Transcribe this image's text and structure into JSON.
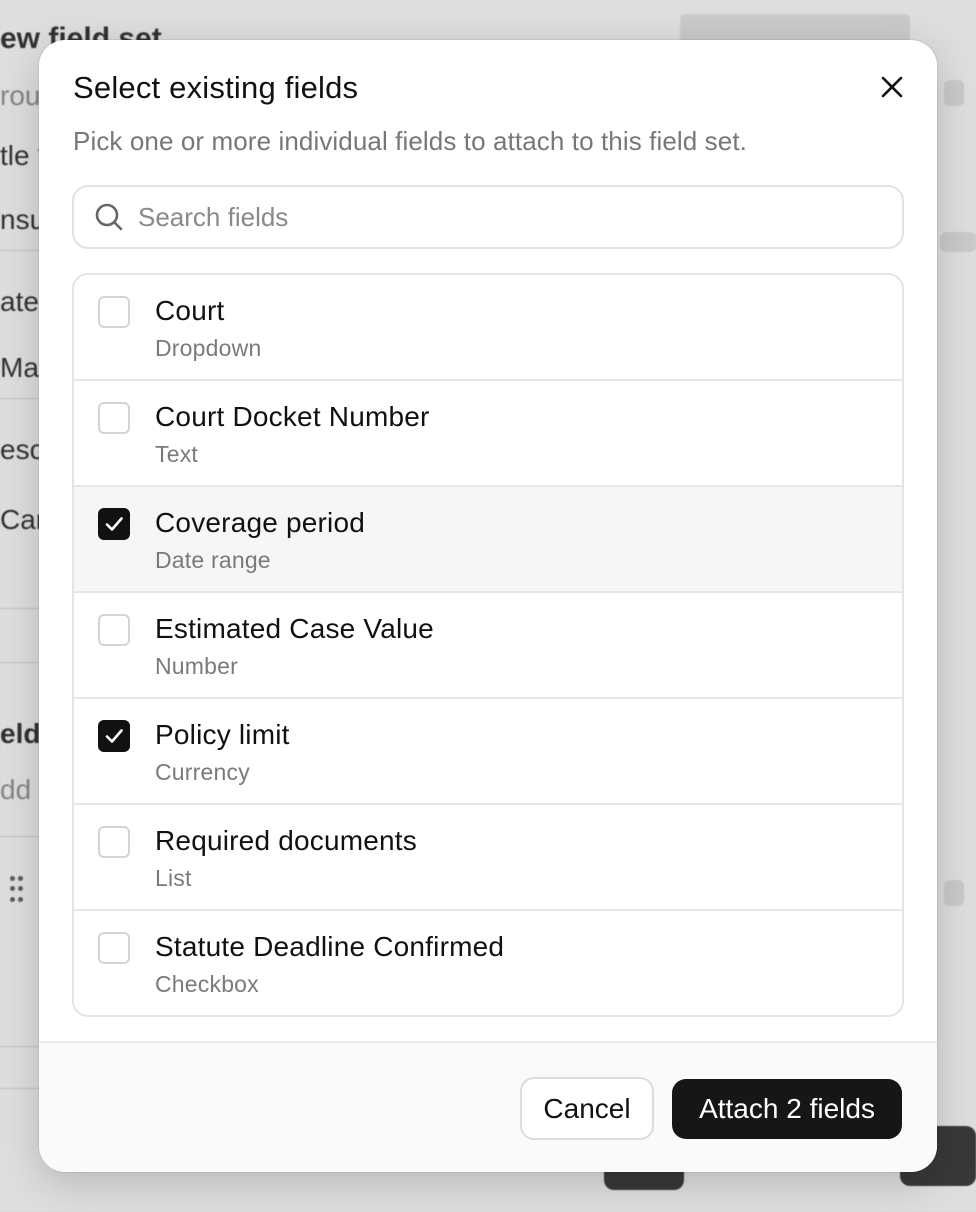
{
  "background": {
    "heading": "ew field set",
    "group_label": "rou",
    "title_label": "tle",
    "title_value": "nsu",
    "category_label": "ateg",
    "category_value": "Mat",
    "description_label": "esc",
    "description_value": "Car",
    "fields_label": "eld",
    "fields_hint": "dd c"
  },
  "modal": {
    "title": "Select existing fields",
    "subtitle": "Pick one or more individual fields to attach to this field set.",
    "search": {
      "placeholder": "Search fields",
      "value": ""
    },
    "fields": [
      {
        "name": "Court",
        "type": "Dropdown",
        "checked": false
      },
      {
        "name": "Court Docket Number",
        "type": "Text",
        "checked": false
      },
      {
        "name": "Coverage period",
        "type": "Date range",
        "checked": true,
        "highlight": true
      },
      {
        "name": "Estimated Case Value",
        "type": "Number",
        "checked": false
      },
      {
        "name": "Policy limit",
        "type": "Currency",
        "checked": true
      },
      {
        "name": "Required documents",
        "type": "List",
        "checked": false
      },
      {
        "name": "Statute Deadline Confirmed",
        "type": "Checkbox",
        "checked": false
      }
    ],
    "footer": {
      "cancel_label": "Cancel",
      "attach_label": "Attach 2 fields"
    }
  },
  "icons": {
    "close": "close-icon",
    "search": "search-icon",
    "check": "check-icon",
    "grip": "drag-handle-icon"
  },
  "colors": {
    "primary_button": "#161616",
    "checkbox_checked": "#111111",
    "muted_text": "#7a7a7a",
    "border": "#e4e4e4"
  }
}
